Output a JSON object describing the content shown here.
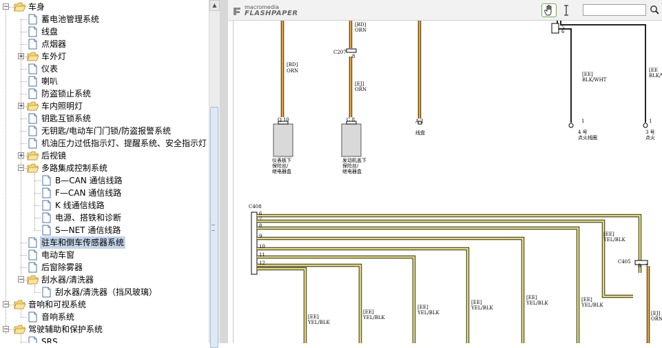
{
  "tree": {
    "items": [
      {
        "label": "车身",
        "level": 0,
        "kind": "folder",
        "expander": "−"
      },
      {
        "label": "蓄电池管理系统",
        "level": 1,
        "kind": "page"
      },
      {
        "label": "线盘",
        "level": 1,
        "kind": "page"
      },
      {
        "label": "点烟器",
        "level": 1,
        "kind": "page"
      },
      {
        "label": "车外灯",
        "level": 1,
        "kind": "folder",
        "expander": "+"
      },
      {
        "label": "仪表",
        "level": 1,
        "kind": "page"
      },
      {
        "label": "喇叭",
        "level": 1,
        "kind": "page"
      },
      {
        "label": "防盗锁止系统",
        "level": 1,
        "kind": "page"
      },
      {
        "label": "车内照明灯",
        "level": 1,
        "kind": "folder",
        "expander": "+"
      },
      {
        "label": "钥匙互锁系统",
        "level": 1,
        "kind": "page"
      },
      {
        "label": "无钥匙/电动车门门锁/防盗报警系统",
        "level": 1,
        "kind": "page"
      },
      {
        "label": "机油压力过低指示灯、提醒系统、安全指示灯",
        "level": 1,
        "kind": "page"
      },
      {
        "label": "后视镜",
        "level": 1,
        "kind": "folder",
        "expander": "+"
      },
      {
        "label": "多路集成控制系统",
        "level": 1,
        "kind": "folder",
        "expander": "−"
      },
      {
        "label": "B—CAN 通信线路",
        "level": 2,
        "kind": "page"
      },
      {
        "label": "F—CAN 通信线路",
        "level": 2,
        "kind": "page"
      },
      {
        "label": "K 线通信线路",
        "level": 2,
        "kind": "page"
      },
      {
        "label": "电源、搭铁和诊断",
        "level": 2,
        "kind": "page"
      },
      {
        "label": "S—NET 通信线路",
        "level": 2,
        "kind": "page"
      },
      {
        "label": "驻车和倒车传感器系统",
        "level": 1,
        "kind": "page",
        "selected": true
      },
      {
        "label": "电动车窗",
        "level": 1,
        "kind": "page"
      },
      {
        "label": "后窗除雾器",
        "level": 1,
        "kind": "page"
      },
      {
        "label": "刮水器/清洗器",
        "level": 1,
        "kind": "folder",
        "expander": "−"
      },
      {
        "label": "刮水器/清洗器（挡风玻璃）",
        "level": 2,
        "kind": "page"
      },
      {
        "label": "音响和可视系统",
        "level": 0,
        "kind": "folder",
        "expander": "−"
      },
      {
        "label": "音响系统",
        "level": 1,
        "kind": "page"
      },
      {
        "label": "驾驶辅助和保护系统",
        "level": 0,
        "kind": "folder",
        "expander": "−"
      },
      {
        "label": "SRS",
        "level": 1,
        "kind": "page"
      }
    ]
  },
  "viewer": {
    "logo_small": "macromedia",
    "logo_big": "FLASHPAPER",
    "hand_tool": "hand-icon",
    "select_tool": "text-select-icon",
    "search_placeholder": "",
    "search_icon": "magnifier-icon"
  },
  "diagram": {
    "colors": {
      "orange": "#f5a623",
      "yellow": "#e8e070",
      "wire": "#222222"
    },
    "labels": [
      {
        "id": "l1",
        "text": "[BD]"
      },
      {
        "id": "l2",
        "text": "ORN"
      },
      {
        "id": "l3",
        "text": "[BD]"
      },
      {
        "id": "l4",
        "text": "ORN"
      },
      {
        "id": "l5",
        "text": "C207"
      },
      {
        "id": "l6",
        "text": "8"
      },
      {
        "id": "l7",
        "text": "[EJ]"
      },
      {
        "id": "l8",
        "text": "ORN"
      },
      {
        "id": "l9",
        "text": "Q 10"
      },
      {
        "id": "l10",
        "text": "C 8"
      },
      {
        "id": "l11",
        "text": "A 2"
      },
      {
        "id": "l12",
        "text": "线盘"
      },
      {
        "id": "l13",
        "text": "仪表板下"
      },
      {
        "id": "l14",
        "text": "保险丝/"
      },
      {
        "id": "l15",
        "text": "继电器盒"
      },
      {
        "id": "l16",
        "text": "发动机盖下"
      },
      {
        "id": "l17",
        "text": "保险丝/"
      },
      {
        "id": "l18",
        "text": "继电器盒"
      },
      {
        "id": "l19",
        "text": "[EE]"
      },
      {
        "id": "l20",
        "text": "BLK/WHT"
      },
      {
        "id": "l21",
        "text": "[EE"
      },
      {
        "id": "l22",
        "text": "BLK/W"
      },
      {
        "id": "l23",
        "text": "1"
      },
      {
        "id": "l24",
        "text": "4 号"
      },
      {
        "id": "l25",
        "text": "点火线圈"
      },
      {
        "id": "l26",
        "text": "1"
      },
      {
        "id": "l27",
        "text": "3 号"
      },
      {
        "id": "l28",
        "text": "点火"
      },
      {
        "id": "l29",
        "text": "C408"
      },
      {
        "id": "l30",
        "text": "6"
      },
      {
        "id": "l31",
        "text": "7"
      },
      {
        "id": "l32",
        "text": "8"
      },
      {
        "id": "l33",
        "text": "9"
      },
      {
        "id": "l34",
        "text": "10"
      },
      {
        "id": "l35",
        "text": "11"
      },
      {
        "id": "l36",
        "text": "12"
      },
      {
        "id": "l37",
        "text": "[EE]"
      },
      {
        "id": "l38",
        "text": "YEL/BLK"
      },
      {
        "id": "l39",
        "text": "C405"
      },
      {
        "id": "l40",
        "text": "8"
      },
      {
        "id": "l41",
        "text": "1"
      },
      {
        "id": "l42",
        "text": "[EE]"
      },
      {
        "id": "l43",
        "text": "YEL/BLK"
      },
      {
        "id": "l44",
        "text": "[EE]"
      },
      {
        "id": "l45",
        "text": "YEL/BLK"
      },
      {
        "id": "l46",
        "text": "[EE]"
      },
      {
        "id": "l47",
        "text": "YEL/BLK"
      },
      {
        "id": "l48",
        "text": "[EE]"
      },
      {
        "id": "l49",
        "text": "YEL/BLK"
      },
      {
        "id": "l50",
        "text": "[EE]"
      },
      {
        "id": "l51",
        "text": "YEL/BLK"
      },
      {
        "id": "l52",
        "text": "[EE]"
      },
      {
        "id": "l53",
        "text": "YEL/BLK"
      },
      {
        "id": "l54",
        "text": "[EJ]"
      },
      {
        "id": "l55",
        "text": "ORN"
      },
      {
        "id": "l56",
        "text": "5"
      },
      {
        "id": "l57",
        "text": "6"
      }
    ]
  }
}
